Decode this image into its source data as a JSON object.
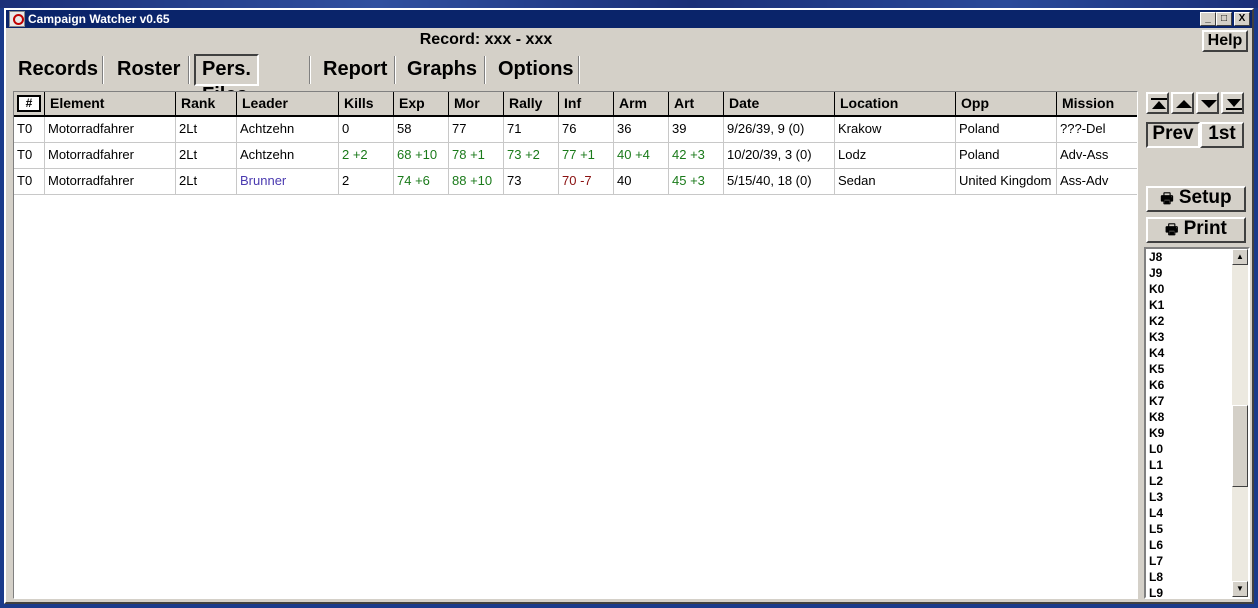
{
  "window": {
    "title": "Campaign Watcher v0.65",
    "controls": [
      "_",
      "□",
      "X"
    ]
  },
  "record_label": "Record: xxx - xxx",
  "help_label": "Help",
  "tabs": [
    {
      "label": "Records",
      "active": false
    },
    {
      "label": "Roster",
      "active": false
    },
    {
      "label": "Pers. Files",
      "active": true
    },
    {
      "label": "Report",
      "active": false
    },
    {
      "label": "Graphs",
      "active": false
    },
    {
      "label": "Options",
      "active": false
    }
  ],
  "table": {
    "hash_label": "#",
    "columns": [
      "Element",
      "Rank",
      "Leader",
      "Kills",
      "Exp",
      "Mor",
      "Rally",
      "Inf",
      "Arm",
      "Art",
      "Date",
      "Location",
      "Opp",
      "Mission"
    ],
    "rows": [
      [
        "T0",
        "Motorradfahrer",
        "2Lt",
        "Achtzehn",
        "0",
        "58",
        "77",
        "71",
        "76",
        "36",
        "39",
        "9/26/39, 9 (0)",
        "Krakow",
        "Poland",
        "???-Del"
      ],
      [
        "T0",
        "Motorradfahrer",
        "2Lt",
        "Achtzehn",
        "2 +2",
        "68 +10",
        "78 +1",
        "73 +2",
        "77 +1",
        "40 +4",
        "42 +3",
        "10/20/39, 3 (0)",
        "Lodz",
        "Poland",
        "Adv-Ass"
      ],
      [
        "T0",
        "Motorradfahrer",
        "2Lt",
        "Brunner",
        "2",
        "74 +6",
        "88 +10",
        "73",
        "70 -7",
        "40",
        "45 +3",
        "5/15/40, 18 (0)",
        "Sedan",
        "United Kingdom",
        "Ass-Adv"
      ]
    ]
  },
  "side_buttons": {
    "prev": "Prev",
    "first": "1st",
    "setup": "Setup",
    "print": "Print"
  },
  "list_items": [
    "J8",
    "J9",
    "K0",
    "K1",
    "K2",
    "K3",
    "K4",
    "K5",
    "K6",
    "K7",
    "K8",
    "K9",
    "L0",
    "L1",
    "L2",
    "L3",
    "L4",
    "L5",
    "L6",
    "L7",
    "L8",
    "L9"
  ],
  "colors": {
    "titlebar": "#0a246a",
    "window_bg": "#d4d0c8",
    "positive_delta": "#1a7a1a",
    "negative_delta": "#8a1010",
    "changed_leader": "#4a3ab0"
  }
}
